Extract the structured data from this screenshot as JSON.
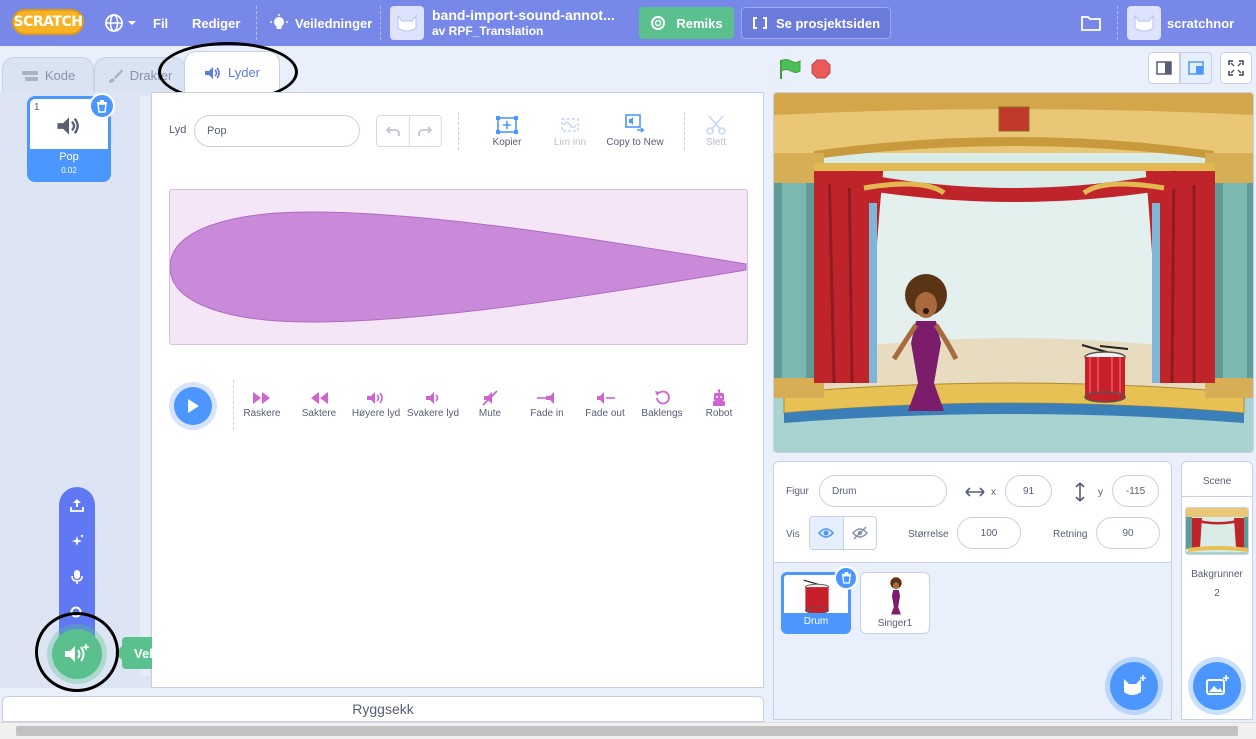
{
  "menu": {
    "logo": "SCRATCH",
    "file": "Fil",
    "edit": "Rediger",
    "tutorials": "Veiledninger",
    "project_title": "band-import-sound-annot...",
    "project_author": "av RPF_Translation",
    "remix": "Remiks",
    "see_project": "Se prosjektsiden",
    "username": "scratchnor"
  },
  "tabs": [
    {
      "label": "Kode",
      "icon": "code-icon"
    },
    {
      "label": "Drakter",
      "icon": "brush-icon"
    },
    {
      "label": "Lyder",
      "icon": "speaker-icon",
      "active": true
    }
  ],
  "sound_list": [
    {
      "index": "1",
      "name": "Pop",
      "duration": "0.02"
    }
  ],
  "add_sound": {
    "tooltip": "Velg en lyd",
    "options": [
      "upload-icon",
      "surprise-icon",
      "record-icon",
      "search-icon"
    ]
  },
  "editor": {
    "name_label": "Lyd",
    "name_value": "Pop",
    "tools": [
      {
        "label": "Kopier",
        "icon": "copy-icon",
        "enabled": true
      },
      {
        "label": "Lim inn",
        "icon": "paste-icon",
        "enabled": false
      },
      {
        "label": "Copy to New",
        "icon": "copy-to-new-icon",
        "enabled": true
      },
      {
        "label": "Slett",
        "icon": "scissors-icon",
        "enabled": false
      }
    ],
    "effects": [
      {
        "label": "Raskere",
        "icon": "faster-icon"
      },
      {
        "label": "Saktere",
        "icon": "slower-icon"
      },
      {
        "label": "Høyere lyd",
        "icon": "louder-icon"
      },
      {
        "label": "Svakere lyd",
        "icon": "softer-icon"
      },
      {
        "label": "Mute",
        "icon": "mute-icon"
      },
      {
        "label": "Fade in",
        "icon": "fade-in-icon"
      },
      {
        "label": "Fade out",
        "icon": "fade-out-icon"
      },
      {
        "label": "Baklengs",
        "icon": "reverse-icon"
      },
      {
        "label": "Robot",
        "icon": "robot-icon"
      }
    ]
  },
  "backpack": "Ryggsekk",
  "sprite_info": {
    "sprite_label": "Figur",
    "sprite_name": "Drum",
    "x_label": "x",
    "x_value": "91",
    "y_label": "y",
    "y_value": "-115",
    "show_label": "Vis",
    "size_label": "Størrelse",
    "size_value": "100",
    "direction_label": "Retning",
    "direction_value": "90"
  },
  "sprites": [
    {
      "name": "Drum",
      "selected": true
    },
    {
      "name": "Singer1",
      "selected": false
    }
  ],
  "scene": {
    "title": "Scene",
    "backdrops_label": "Bakgrunner",
    "backdrops_count": "2"
  },
  "colors": {
    "menubar": "#7788e8",
    "accent": "#4c97ff",
    "green": "#59c08e",
    "waveform": "#c98bd9"
  }
}
